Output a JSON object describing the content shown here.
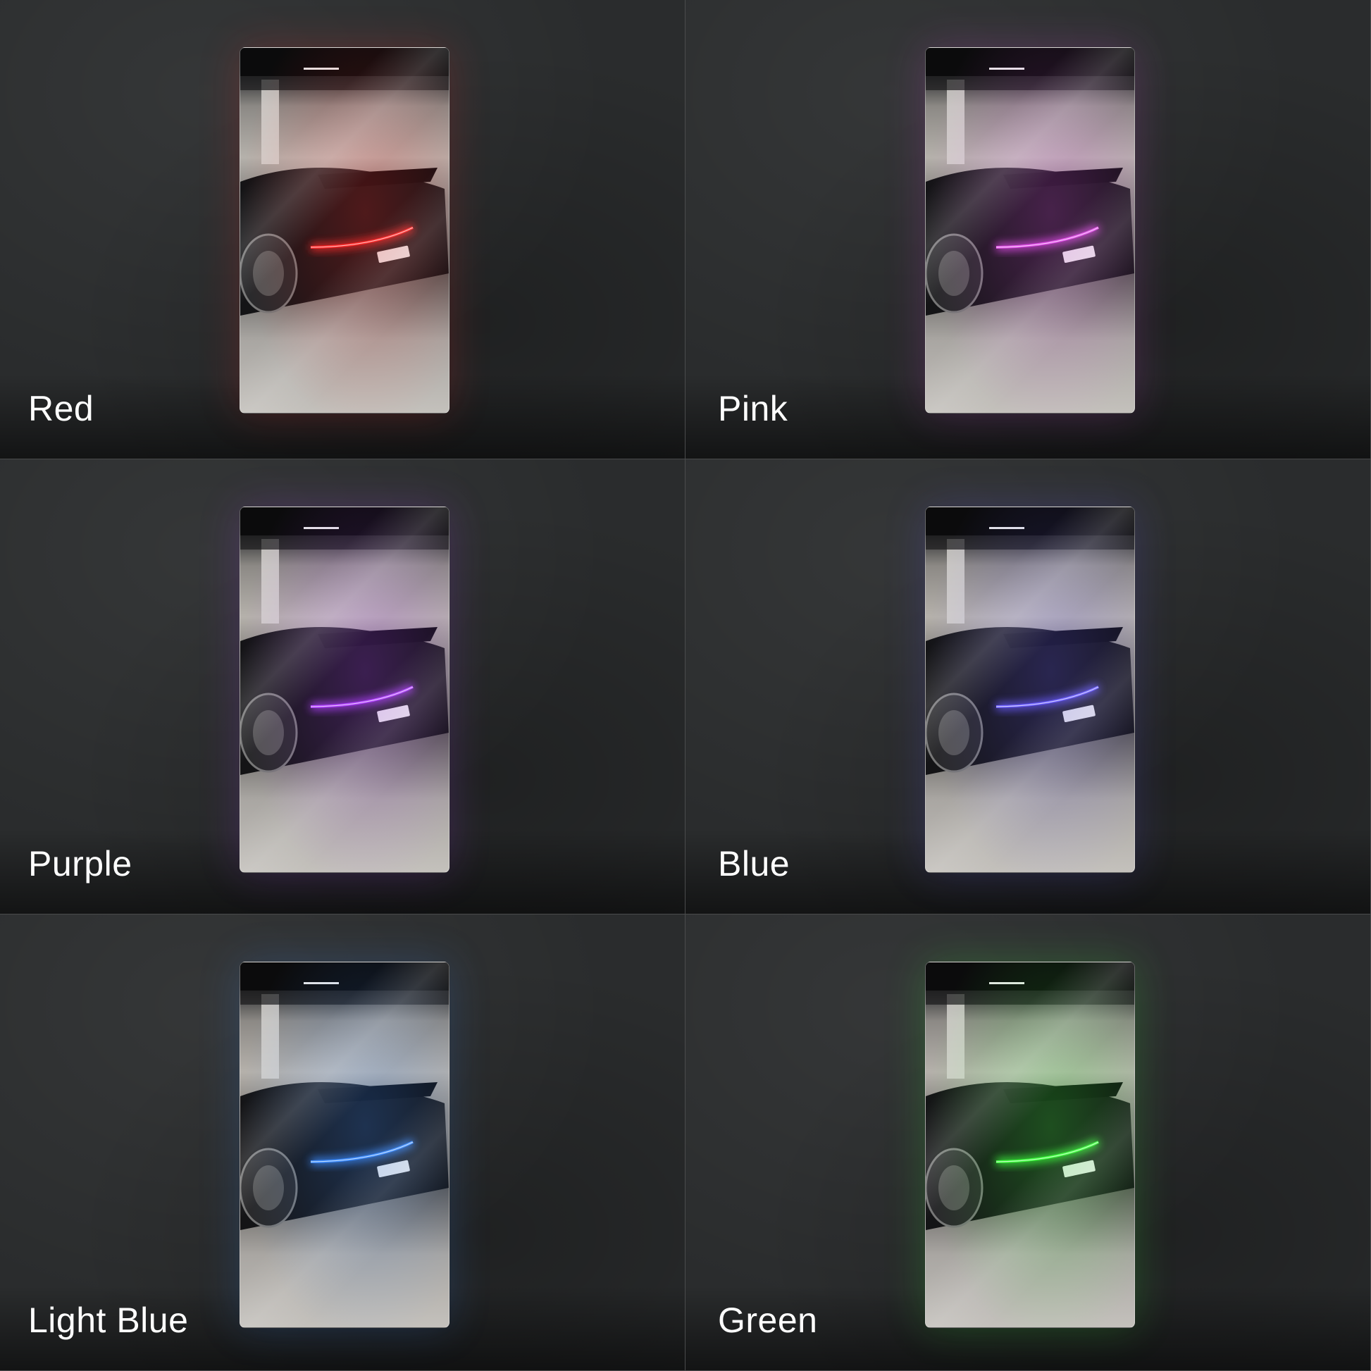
{
  "variants": [
    {
      "label": "Red",
      "color": "#ff2a2a"
    },
    {
      "label": "Pink",
      "color": "#e04ce8"
    },
    {
      "label": "Purple",
      "color": "#b040ff"
    },
    {
      "label": "Blue",
      "color": "#6a5cff"
    },
    {
      "label": "Light Blue",
      "color": "#3c8cff"
    },
    {
      "label": "Green",
      "color": "#3cff3c"
    }
  ]
}
